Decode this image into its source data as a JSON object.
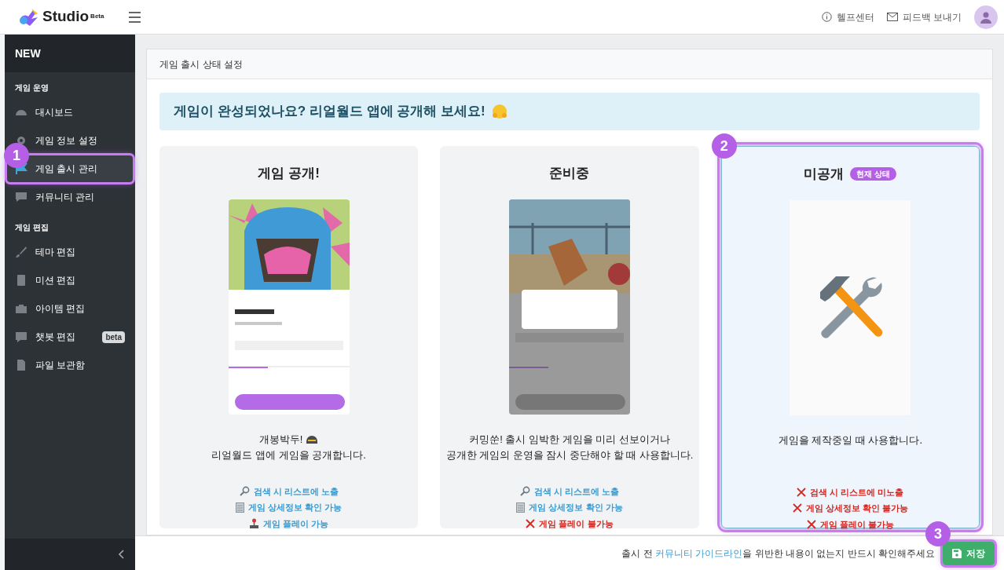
{
  "header": {
    "logo": "Studio",
    "logo_sup": "Beta",
    "links": [
      {
        "kind": "info",
        "label": "헬프센터"
      },
      {
        "kind": "mail",
        "label": "피드백 보내기"
      }
    ]
  },
  "sidebar": {
    "title": "NEW",
    "sections": [
      {
        "heading": "게임 운영",
        "items": [
          {
            "kind": "gauge",
            "label": "대시보드",
            "selected": false
          },
          {
            "kind": "gear",
            "label": "게임 정보 설정",
            "selected": false
          },
          {
            "kind": "flag",
            "label": "게임 출시 관리",
            "selected": true,
            "annotation": "1"
          },
          {
            "kind": "chat",
            "label": "커뮤니티 관리",
            "selected": false
          }
        ]
      },
      {
        "heading": "게임 편집",
        "items": [
          {
            "kind": "brush",
            "label": "테마 편집",
            "selected": false
          },
          {
            "kind": "book",
            "label": "미션 편집",
            "selected": false
          },
          {
            "kind": "toolbox",
            "label": "아이템 편집",
            "selected": false
          },
          {
            "kind": "bot",
            "label": "챗봇 편집",
            "selected": false,
            "badge": "beta"
          },
          {
            "kind": "file",
            "label": "파일 보관함",
            "selected": false
          }
        ]
      }
    ]
  },
  "panel": {
    "title": "게임 출시 상태 설정",
    "banner": "게임이 완성되었나요? 리얼월드 앱에 공개해 보세요!",
    "cards": [
      {
        "title": "게임 공개!",
        "selected": false,
        "preview": {
          "kind": "picture"
        },
        "lines": [
          {
            "kind": "emoji",
            "text": "개봉박두!"
          },
          {
            "kind": "plain",
            "text": "리얼월드 앱에 게임을 공개합니다."
          }
        ],
        "features": [
          {
            "kind": "search",
            "text": "검색 시 리스트에 노출",
            "allowed": true
          },
          {
            "kind": "memo",
            "text": "게임 상세정보 확인 가능",
            "allowed": true
          },
          {
            "kind": "joystick",
            "text": "게임 플레이 가능",
            "allowed": true
          }
        ]
      },
      {
        "title": "준비중",
        "selected": false,
        "preview": {
          "kind": "picture"
        },
        "lines": [
          {
            "kind": "plain",
            "text": "커밍쑨! 출시 임박한 게임을 미리 선보이거나"
          },
          {
            "kind": "plain",
            "text": "공개한 게임의 운영을 잠시 중단해야 할 때 사용합니다."
          }
        ],
        "features": [
          {
            "kind": "search",
            "text": "검색 시 리스트에 노출",
            "allowed": true
          },
          {
            "kind": "memo",
            "text": "게임 상세정보 확인 가능",
            "allowed": true
          },
          {
            "text": "게임 플레이 불가능",
            "allowed": false
          }
        ]
      },
      {
        "title": "미공개",
        "selected": true,
        "badge": "현재 상태",
        "annotation": "2",
        "preview": {
          "kind": "tools"
        },
        "lines": [
          {
            "kind": "plain",
            "text": "게임을 제작중일 때 사용합니다."
          }
        ],
        "features": [
          {
            "text": "검색 시 리스트에 미노출",
            "allowed": false
          },
          {
            "text": "게임 상세정보 확인 불가능",
            "allowed": false
          },
          {
            "text": "게임 플레이 불가능",
            "allowed": false
          }
        ]
      }
    ]
  },
  "footer": {
    "before": "출시 전 ",
    "link": "커뮤니티 가이드라인",
    "after": "을 위반한 내용이 없는지 반드시 확인해주세요",
    "save": {
      "label": "저장",
      "annotation": "3"
    }
  }
}
